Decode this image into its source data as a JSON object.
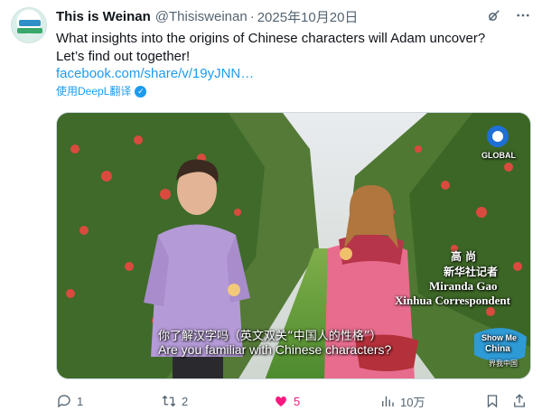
{
  "account": {
    "name": "This is Weinan",
    "handle": "@Thisisweinan",
    "separator": "·",
    "date": "2025年10月20日"
  },
  "tweet": {
    "line1": "What insights into the origins of Chinese characters will Adam uncover?",
    "line2": "Let’s find out together!",
    "link": "facebook.com/share/v/19yJNN…",
    "translate_label": "使用DeepL翻译"
  },
  "media": {
    "caption_name_cn": "高 尚",
    "caption_title_cn": "新华社记者",
    "caption_name_en": "Miranda Gao",
    "caption_title_en": "Xinhua Correspondent",
    "subtitle_cn": "你了解汉字吗（英文双关“中国人的性格”）",
    "subtitle_en": "Are you familiar with Chinese characters?",
    "corner_logo_text": "GLOBAL",
    "brand_text_1": "Show Me",
    "brand_text_2": "China",
    "brand_text_3": "界我中国"
  },
  "actions": {
    "replies": "1",
    "retweets": "2",
    "likes": "5",
    "views": "10万",
    "liked": true
  },
  "icons": {
    "grok": "grok-icon",
    "more": "more-icon",
    "reply": "reply-icon",
    "retweet": "retweet-icon",
    "like": "heart-icon",
    "views": "views-icon",
    "bookmark": "bookmark-icon",
    "share": "share-icon"
  },
  "colors": {
    "link": "#1d9bf0",
    "like": "#f91880",
    "muted": "#536471"
  }
}
